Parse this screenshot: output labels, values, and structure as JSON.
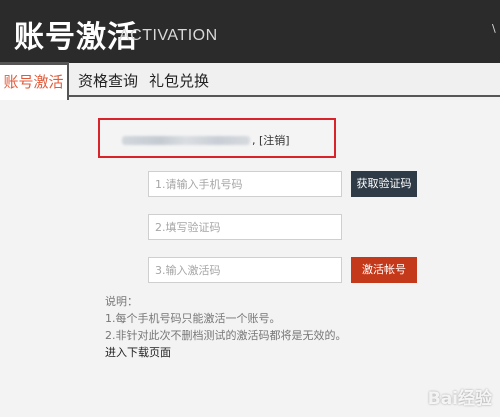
{
  "header": {
    "title": "账号激活",
    "subtitle": "ACTIVATION",
    "corner_text": "\\"
  },
  "tabs": [
    {
      "label": "账号激活",
      "active": true
    },
    {
      "label": "资格查询",
      "active": false
    },
    {
      "label": "礼包兑换",
      "active": false
    }
  ],
  "account": {
    "logout_label": ", [注销]"
  },
  "form": {
    "phone_placeholder": "1.请输入手机号码",
    "code_placeholder": "2.填写验证码",
    "activation_placeholder": "3.输入激活码",
    "get_code_label": "获取验证码",
    "activate_label": "激活帐号"
  },
  "notes": {
    "label": "说明：",
    "items": [
      "1.每个手机号码只能激活一个账号。",
      "2.非针对此次不删档测试的激活码都将是无效的。"
    ],
    "download_link": "进入下载页面"
  },
  "watermark": "Bai经验",
  "colors": {
    "header_bg": "#2b2b2b",
    "active_tab": "#e25a3a",
    "highlight_border": "#d9222a",
    "get_code_button": "#2f3b46",
    "activate_button": "#c5391b"
  }
}
